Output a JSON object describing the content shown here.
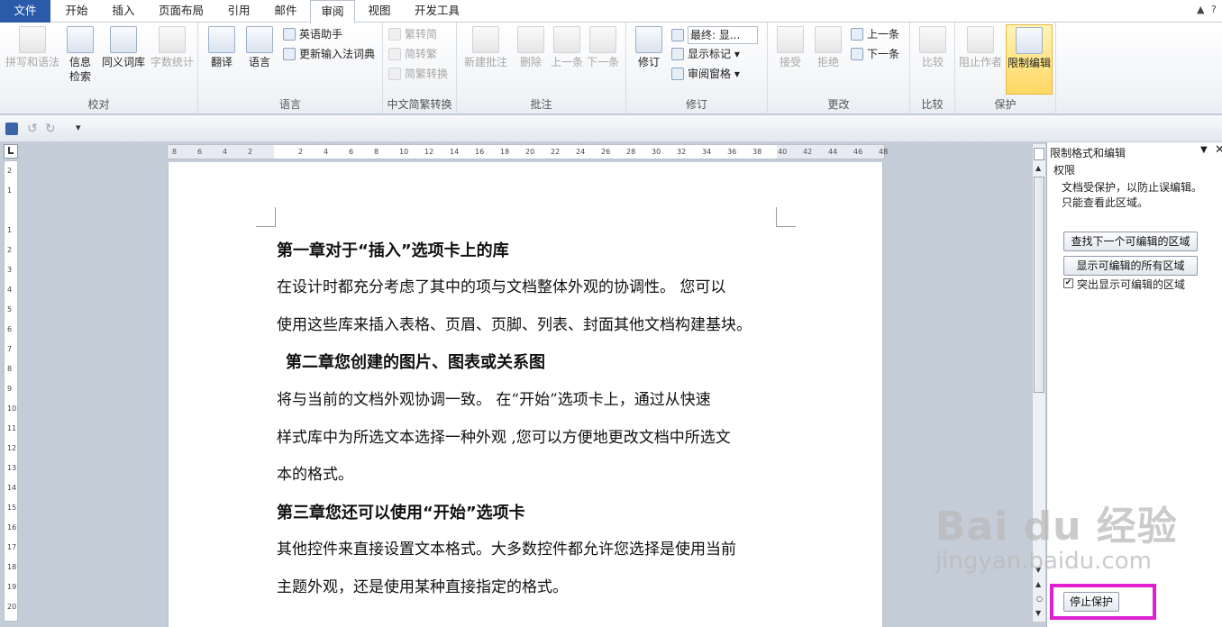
{
  "tabs": {
    "file": "文件",
    "home": "开始",
    "insert": "插入",
    "layout": "页面布局",
    "references": "引用",
    "mailings": "邮件",
    "review": "审阅",
    "view": "视图",
    "developer": "开发工具"
  },
  "groups": {
    "proofing": "校对",
    "language": "语言",
    "chinese_conversion": "中文简繁转换",
    "comments": "批注",
    "tracking": "修订",
    "changes": "更改",
    "compare": "比较",
    "protect": "保护"
  },
  "buttons": {
    "spelling": "拼写和语法",
    "research_l1": "信息",
    "research_l2": "检索",
    "thesaurus": "同义词库",
    "word_count": "字数统计",
    "translate": "翻译",
    "language": "语言",
    "english_assistant": "英语助手",
    "update_ime": "更新输入法词典",
    "trad_to_simp": "繁转简",
    "simp_to_trad": "简转繁",
    "conversion": "简繁转换",
    "new_comment": "新建批注",
    "delete": "删除",
    "prev_comment": "上一条",
    "next_comment": "下一条",
    "track_changes": "修订",
    "final_display": "最终: 显...",
    "show_markup": "显示标记",
    "reviewing_pane": "审阅窗格",
    "accept": "接受",
    "reject": "拒绝",
    "prev_change": "上一条",
    "next_change": "下一条",
    "compare": "比较",
    "block_authors": "阻止作者",
    "restrict_editing": "限制编辑"
  },
  "document": {
    "h1": "第一章对于“插入”选项卡上的库",
    "p1_l1": "在设计时都充分考虑了其中的项与文档整体外观的协调性。  您可以",
    "p1_l2": "使用这些库来插入表格、页眉、页脚、列表、封面其他文档构建基块。",
    "h2": "第二章您创建的图片、图表或关系图",
    "p2_l1": "将与当前的文档外观协调一致。  在“开始”选项卡上，通过从快速",
    "p2_l2": "样式库中为所选文本选择一种外观 ,您可以方便地更改文档中所选文",
    "p2_l3": "本的格式。",
    "h3": "第三章您还可以使用“开始”选项卡",
    "p3_l1": "其他控件来直接设置文本格式。大多数控件都允许您选择是使用当前",
    "p3_l2": "主题外观，还是使用某种直接指定的格式。"
  },
  "ruler": {
    "h_ticks": [
      "8",
      "6",
      "4",
      "2",
      "",
      "2",
      "4",
      "6",
      "8",
      "10",
      "12",
      "14",
      "16",
      "18",
      "20",
      "22",
      "24",
      "26",
      "28",
      "30",
      "32",
      "34",
      "36",
      "38",
      "40",
      "42",
      "44",
      "46",
      "48"
    ],
    "v_ticks": [
      "2",
      "1",
      "",
      "1",
      "2",
      "3",
      "4",
      "5",
      "6",
      "7",
      "8",
      "9",
      "10",
      "11",
      "12",
      "13",
      "14",
      "15",
      "16",
      "17",
      "18",
      "19",
      "20"
    ]
  },
  "pane": {
    "title": "限制格式和编辑",
    "section": "权限",
    "info_l1": "文档受保护，以防止误编辑。",
    "info_l2": "只能查看此区域。",
    "find_next_region": "查找下一个可编辑的区域",
    "show_all_regions": "显示可编辑的所有区域",
    "highlight_label": "突出显示可编辑的区域",
    "highlight_checked": true,
    "stop_protection": "停止保护"
  },
  "watermark": {
    "brand": "Bai du 经验",
    "url": "jingyan.baidu.com"
  },
  "colors": {
    "file_tab": "#2a5bab",
    "highlight_box": "#e020d0",
    "active_button": "#ffd864"
  }
}
